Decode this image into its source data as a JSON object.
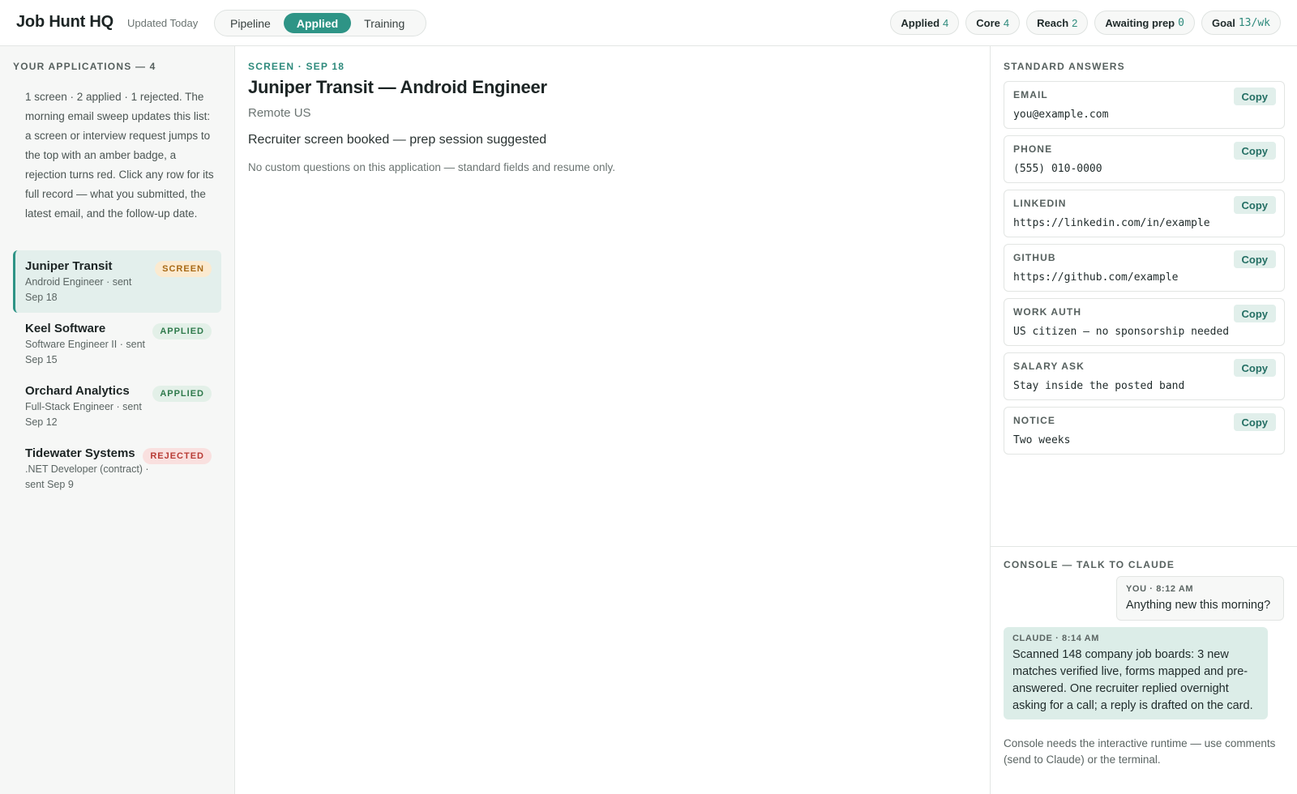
{
  "header": {
    "brand": "Job Hunt HQ",
    "updated": "Updated Today",
    "tabs": [
      "Pipeline",
      "Applied",
      "Training"
    ],
    "active_tab": "Applied",
    "stats": [
      {
        "label": "Applied",
        "value": "4"
      },
      {
        "label": "Core",
        "value": "4"
      },
      {
        "label": "Reach",
        "value": "2"
      },
      {
        "label": "Awaiting prep",
        "value": "0"
      },
      {
        "label": "Goal",
        "value": "13/wk"
      }
    ]
  },
  "sidebar": {
    "heading": "YOUR APPLICATIONS — 4",
    "intro": "1 screen · 2 applied · 1 rejected. The morning email sweep updates this list: a screen or interview request jumps to the top with an amber badge, a rejection turns red. Click any row for its full record — what you submitted, the latest email, and the follow-up date.",
    "applications": [
      {
        "company": "Juniper Transit",
        "sub": "Android Engineer · sent Sep 18",
        "badge": "SCREEN",
        "status": "screen"
      },
      {
        "company": "Keel Software",
        "sub": "Software Engineer II · sent Sep 15",
        "badge": "APPLIED",
        "status": "applied"
      },
      {
        "company": "Orchard Analytics",
        "sub": "Full-Stack Engineer · sent Sep 12",
        "badge": "APPLIED",
        "status": "applied"
      },
      {
        "company": "Tidewater Systems",
        "sub": ".NET Developer (contract) · sent Sep 9",
        "badge": "REJECTED",
        "status": "rejected"
      }
    ]
  },
  "main": {
    "eyebrow": "SCREEN · SEP 18",
    "title": "Juniper Transit — Android Engineer",
    "location": "Remote US",
    "status_line": "Recruiter screen booked — prep session suggested",
    "note": "No custom questions on this application — standard fields and resume only."
  },
  "answers": {
    "heading": "STANDARD ANSWERS",
    "copy_label": "Copy",
    "items": [
      {
        "key": "EMAIL",
        "value": "you@example.com"
      },
      {
        "key": "PHONE",
        "value": "(555) 010-0000"
      },
      {
        "key": "LINKEDIN",
        "value": "https://linkedin.com/in/example"
      },
      {
        "key": "GITHUB",
        "value": "https://github.com/example"
      },
      {
        "key": "WORK AUTH",
        "value": "US citizen — no sponsorship needed"
      },
      {
        "key": "SALARY ASK",
        "value": "Stay inside the posted band"
      },
      {
        "key": "NOTICE",
        "value": "Two weeks"
      }
    ]
  },
  "console": {
    "heading": "CONSOLE — TALK TO CLAUDE",
    "you_meta": "YOU · 8:12 AM",
    "you_text": "Anything new this morning?",
    "claude_meta": "CLAUDE · 8:14 AM",
    "claude_text": "Scanned 148 company job boards: 3 new matches verified live, forms mapped and pre-answered. One recruiter replied overnight asking for a call; a reply is drafted on the card.",
    "note": "Console needs the interactive runtime — use comments (send to Claude) or the terminal."
  }
}
